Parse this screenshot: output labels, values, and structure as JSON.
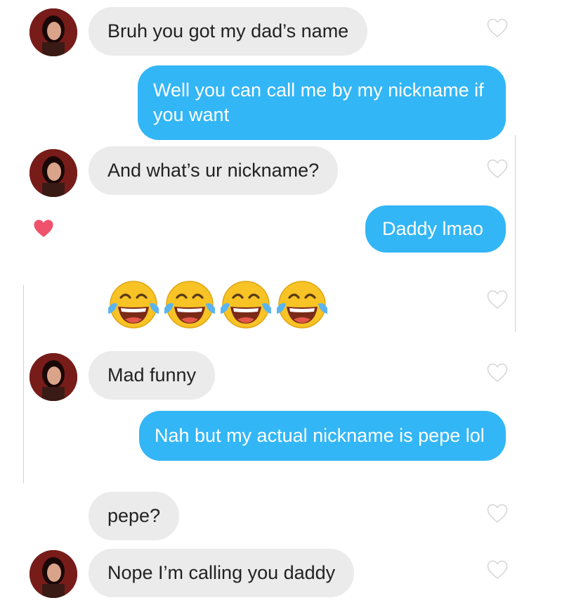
{
  "messages": [
    {
      "id": "m1",
      "side": "in",
      "text": "Bruh you got my dad’s name",
      "avatar": true
    },
    {
      "id": "m2",
      "side": "out",
      "text": "Well you can call me by my nickname if you want"
    },
    {
      "id": "m3",
      "side": "in",
      "text": "And what’s ur nickname?",
      "avatar": true
    },
    {
      "id": "m4",
      "side": "out",
      "text": "Daddy lmao",
      "liked": true
    },
    {
      "id": "m5",
      "side": "in",
      "emoji": "face-with-tears-of-joy",
      "count": 4
    },
    {
      "id": "m6",
      "side": "in",
      "text": "Mad funny",
      "avatar": true
    },
    {
      "id": "m7",
      "side": "out",
      "text": "Nah but my actual nickname is pepe lol"
    },
    {
      "id": "m8",
      "side": "in",
      "text": "pepe?"
    },
    {
      "id": "m9",
      "side": "in",
      "text": "Nope I’m calling you daddy",
      "avatar": true
    }
  ],
  "colors": {
    "incoming_bubble": "#ebebeb",
    "outgoing_bubble": "#32b6f6",
    "incoming_text": "#222222",
    "outgoing_text": "#ffffff",
    "heart_liked": "#f0516b",
    "heart_outline": "#d6d6d6"
  },
  "icons": {
    "like": "heart-icon",
    "liked": "heart-filled-icon"
  }
}
